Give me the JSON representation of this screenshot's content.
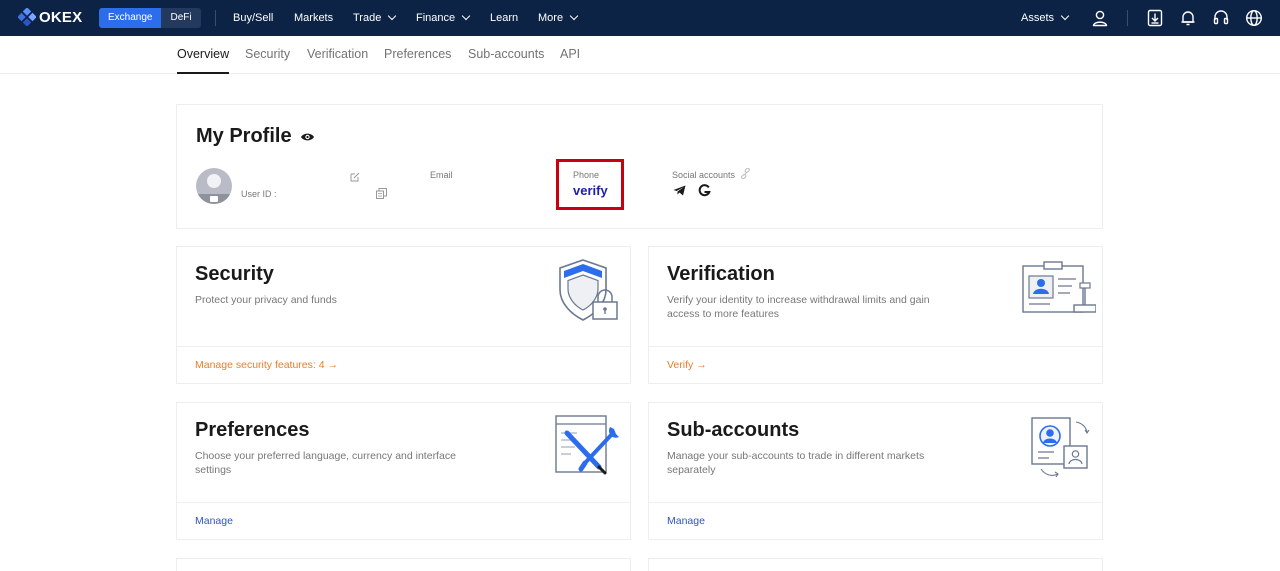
{
  "nav": {
    "logo_text": "OKEX",
    "segments": [
      "Exchange",
      "DeFi"
    ],
    "items": [
      "Buy/Sell",
      "Markets",
      "Trade",
      "Finance",
      "Learn",
      "More"
    ],
    "assets_label": "Assets"
  },
  "tabs": [
    "Overview",
    "Security",
    "Verification",
    "Preferences",
    "Sub-accounts",
    "API"
  ],
  "profile": {
    "title": "My Profile",
    "user_id_label": "User ID :",
    "email_label": "Email",
    "phone_label": "Phone",
    "phone_value": "verify",
    "social_label": "Social accounts"
  },
  "cards": {
    "security": {
      "title": "Security",
      "desc": "Protect your privacy and funds",
      "link": "Manage security features: 4"
    },
    "verification": {
      "title": "Verification",
      "desc": "Verify your identity to increase withdrawal limits and gain access to more features",
      "link": "Verify"
    },
    "preferences": {
      "title": "Preferences",
      "desc": "Choose your preferred language, currency and interface settings",
      "link": "Manage"
    },
    "subaccounts": {
      "title": "Sub-accounts",
      "desc": "Manage your sub-accounts to trade in different markets separately",
      "link": "Manage"
    }
  },
  "colors": {
    "nav_bg": "#0d2345",
    "accent_blue": "#2b6ded",
    "link_orange": "#e87f2a",
    "link_blue": "#2b55c6",
    "highlight_red": "#c8000f"
  }
}
